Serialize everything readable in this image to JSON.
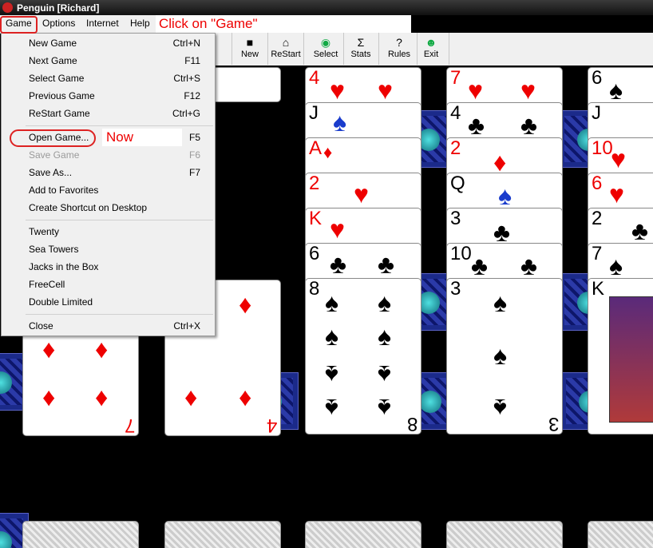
{
  "window": {
    "title": "Penguin [Richard]"
  },
  "menubar": [
    "Game",
    "Options",
    "Internet",
    "Help"
  ],
  "annotations": {
    "top": "Click on \"Game\"",
    "now": "Now"
  },
  "toolbar": [
    {
      "label": "New",
      "icon": "new-icon"
    },
    {
      "label": "ReStart",
      "icon": "restart-icon"
    },
    {
      "label": "Select",
      "icon": "select-icon"
    },
    {
      "label": "Stats",
      "icon": "stats-icon"
    },
    {
      "label": "Rules",
      "icon": "rules-icon"
    },
    {
      "label": "Exit",
      "icon": "exit-icon"
    }
  ],
  "game_menu": [
    {
      "label": "New Game",
      "shortcut": "Ctrl+N"
    },
    {
      "label": "Next Game",
      "shortcut": "F11"
    },
    {
      "label": "Select Game",
      "shortcut": "Ctrl+S"
    },
    {
      "label": "Previous Game",
      "shortcut": "F12"
    },
    {
      "label": "ReStart Game",
      "shortcut": "Ctrl+G"
    },
    {
      "label": "Open Game...",
      "shortcut": "F5"
    },
    {
      "label": "Save Game",
      "shortcut": "F6",
      "disabled": true
    },
    {
      "label": "Save As...",
      "shortcut": "F7"
    },
    {
      "label": "Add to Favorites",
      "shortcut": ""
    },
    {
      "label": "Create Shortcut on Desktop",
      "shortcut": ""
    },
    {
      "label": "Twenty",
      "shortcut": ""
    },
    {
      "label": "Sea Towers",
      "shortcut": ""
    },
    {
      "label": "Jacks in the Box",
      "shortcut": ""
    },
    {
      "label": "FreeCell",
      "shortcut": ""
    },
    {
      "label": "Double Limited",
      "shortcut": ""
    },
    {
      "label": "Close",
      "shortcut": "Ctrl+X"
    }
  ],
  "cards": {
    "c3": [
      "4",
      "J",
      "A",
      "2",
      "K",
      "6",
      "8"
    ],
    "c4": [
      "7",
      "4",
      "2",
      "Q",
      "3",
      "10",
      "3"
    ],
    "c5": [
      "6",
      "J",
      "10",
      "6",
      "2",
      "7",
      "K"
    ],
    "bottom_left": "7",
    "bottom_mid": "4",
    "bottom_c3": "8",
    "bottom_c4": "3"
  }
}
